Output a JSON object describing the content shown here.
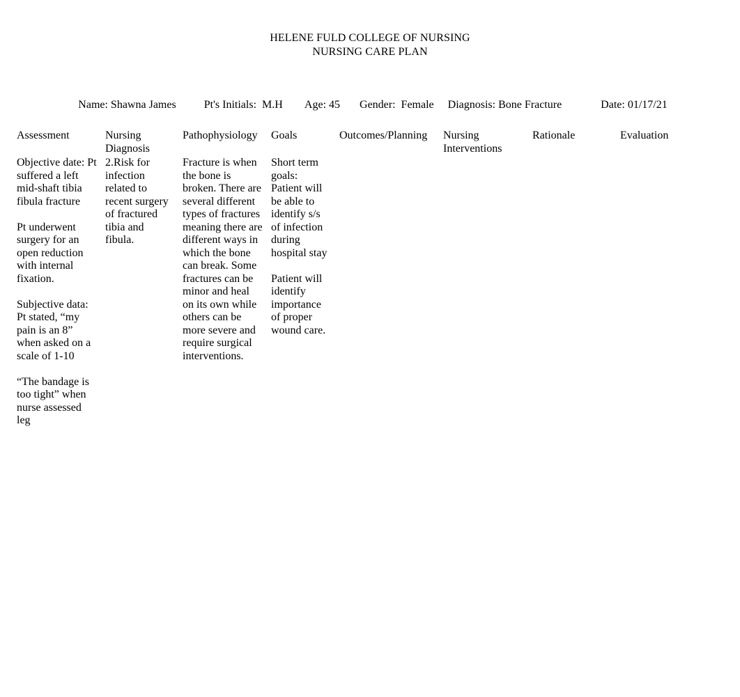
{
  "document": {
    "title_lines": [
      "HELENE FULD COLLEGE OF NURSING",
      "NURSING CARE PLAN"
    ]
  },
  "patient_info": {
    "name_label": "Name:",
    "name_value": "Shawna James",
    "initials_label": "Pt's Initials:",
    "initials_value": "M.H",
    "age_label": "Age:",
    "age_value": "45",
    "gender_label": "Gender:",
    "gender_value": "Female",
    "diagnosis_label": "Diagnosis:",
    "diagnosis_value": "Bone Fracture",
    "date_label": "Date:",
    "date_value": "01/17/21",
    "full_line": "Name: Shawna James          Pt's Initials:  M.H        Age: 45       Gender:  Female     Diagnosis: Bone Fracture              Date: 01/17/21"
  },
  "care_plan": {
    "headers": [
      "Assessment",
      "Nursing Diagnosis",
      "Pathophysiology",
      "Goals",
      "Outcomes/Planning",
      "Nursing Interventions",
      "Rationale",
      "Evaluation"
    ],
    "rows": [
      {
        "assessment": [
          "Objective date: Pt suffered a left mid-shaft tibia fibula fracture",
          "Pt underwent surgery for an open reduction with internal fixation.",
          "Subjective data: Pt stated, “my pain is an 8” when asked on a scale of 1-10",
          "“The bandage is too tight” when nurse assessed leg"
        ],
        "nursing_diagnosis": [
          "2.Risk for infection related to recent surgery of fractured tibia and fibula."
        ],
        "pathophysiology": [
          "Fracture is when the bone is broken. There are several different types of fractures meaning there are different ways in which the bone can break. Some fractures can be minor and heal on its own while others can be more severe and require surgical interventions."
        ],
        "goals": [
          "Short term goals: Patient will be able to identify s/s of infection during hospital stay",
          "Patient will identify importance of proper wound care."
        ],
        "outcomes_planning": [],
        "nursing_interventions": [],
        "rationale": [],
        "evaluation": []
      }
    ]
  }
}
